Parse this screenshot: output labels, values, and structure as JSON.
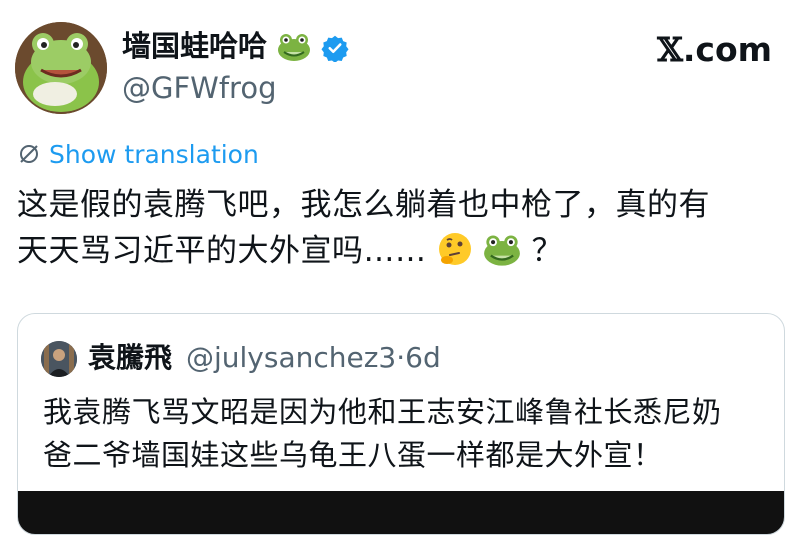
{
  "author": {
    "display_name": "墙国蛙哈哈",
    "handle": "@GFWfrog",
    "avatar_icon": "frog-avatar-icon",
    "name_emoji": "frog-face-emoji",
    "verified_icon": "verified-badge-icon",
    "verified_color": "#1d9bf0"
  },
  "brand": {
    "x_letter": "𝕏",
    "domain": ".com"
  },
  "translation": {
    "label": "Show translation",
    "icon": "translate-globe-icon",
    "color": "#1d9bf0"
  },
  "tweet": {
    "line1": "这是假的袁腾飞吧，我怎么躺着也中枪了，真的有",
    "line2": "天天骂习近平的大外宣吗……",
    "trailing": " ？",
    "emojis": [
      "thinking-face-emoji",
      "frog-face-emoji"
    ]
  },
  "quote": {
    "name": "袁騰飛",
    "handle": "@julysanchez3",
    "separator": "·",
    "time": "6d",
    "line1": "我袁腾飞骂文昭是因为他和王志安江峰鲁社长悉尼奶",
    "line2": "爸二爷墙国娃这些乌龟王八蛋一样都是大外宣！",
    "avatar_icon": "person-avatar-icon"
  }
}
